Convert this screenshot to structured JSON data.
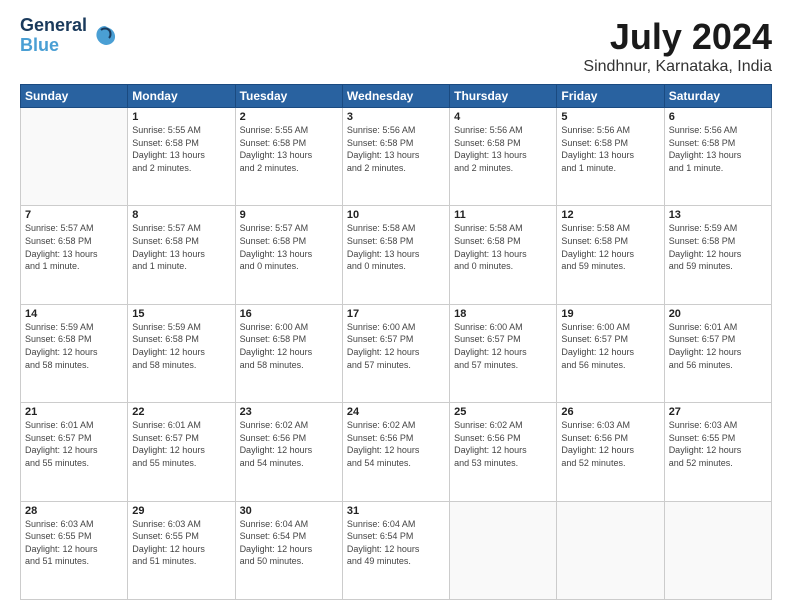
{
  "header": {
    "logo_line1": "General",
    "logo_line2": "Blue",
    "title": "July 2024",
    "subtitle": "Sindhnur, Karnataka, India"
  },
  "columns": [
    "Sunday",
    "Monday",
    "Tuesday",
    "Wednesday",
    "Thursday",
    "Friday",
    "Saturday"
  ],
  "weeks": [
    [
      {
        "day": "",
        "info": ""
      },
      {
        "day": "1",
        "info": "Sunrise: 5:55 AM\nSunset: 6:58 PM\nDaylight: 13 hours\nand 2 minutes."
      },
      {
        "day": "2",
        "info": "Sunrise: 5:55 AM\nSunset: 6:58 PM\nDaylight: 13 hours\nand 2 minutes."
      },
      {
        "day": "3",
        "info": "Sunrise: 5:56 AM\nSunset: 6:58 PM\nDaylight: 13 hours\nand 2 minutes."
      },
      {
        "day": "4",
        "info": "Sunrise: 5:56 AM\nSunset: 6:58 PM\nDaylight: 13 hours\nand 2 minutes."
      },
      {
        "day": "5",
        "info": "Sunrise: 5:56 AM\nSunset: 6:58 PM\nDaylight: 13 hours\nand 1 minute."
      },
      {
        "day": "6",
        "info": "Sunrise: 5:56 AM\nSunset: 6:58 PM\nDaylight: 13 hours\nand 1 minute."
      }
    ],
    [
      {
        "day": "7",
        "info": "Sunrise: 5:57 AM\nSunset: 6:58 PM\nDaylight: 13 hours\nand 1 minute."
      },
      {
        "day": "8",
        "info": "Sunrise: 5:57 AM\nSunset: 6:58 PM\nDaylight: 13 hours\nand 1 minute."
      },
      {
        "day": "9",
        "info": "Sunrise: 5:57 AM\nSunset: 6:58 PM\nDaylight: 13 hours\nand 0 minutes."
      },
      {
        "day": "10",
        "info": "Sunrise: 5:58 AM\nSunset: 6:58 PM\nDaylight: 13 hours\nand 0 minutes."
      },
      {
        "day": "11",
        "info": "Sunrise: 5:58 AM\nSunset: 6:58 PM\nDaylight: 13 hours\nand 0 minutes."
      },
      {
        "day": "12",
        "info": "Sunrise: 5:58 AM\nSunset: 6:58 PM\nDaylight: 12 hours\nand 59 minutes."
      },
      {
        "day": "13",
        "info": "Sunrise: 5:59 AM\nSunset: 6:58 PM\nDaylight: 12 hours\nand 59 minutes."
      }
    ],
    [
      {
        "day": "14",
        "info": "Sunrise: 5:59 AM\nSunset: 6:58 PM\nDaylight: 12 hours\nand 58 minutes."
      },
      {
        "day": "15",
        "info": "Sunrise: 5:59 AM\nSunset: 6:58 PM\nDaylight: 12 hours\nand 58 minutes."
      },
      {
        "day": "16",
        "info": "Sunrise: 6:00 AM\nSunset: 6:58 PM\nDaylight: 12 hours\nand 58 minutes."
      },
      {
        "day": "17",
        "info": "Sunrise: 6:00 AM\nSunset: 6:57 PM\nDaylight: 12 hours\nand 57 minutes."
      },
      {
        "day": "18",
        "info": "Sunrise: 6:00 AM\nSunset: 6:57 PM\nDaylight: 12 hours\nand 57 minutes."
      },
      {
        "day": "19",
        "info": "Sunrise: 6:00 AM\nSunset: 6:57 PM\nDaylight: 12 hours\nand 56 minutes."
      },
      {
        "day": "20",
        "info": "Sunrise: 6:01 AM\nSunset: 6:57 PM\nDaylight: 12 hours\nand 56 minutes."
      }
    ],
    [
      {
        "day": "21",
        "info": "Sunrise: 6:01 AM\nSunset: 6:57 PM\nDaylight: 12 hours\nand 55 minutes."
      },
      {
        "day": "22",
        "info": "Sunrise: 6:01 AM\nSunset: 6:57 PM\nDaylight: 12 hours\nand 55 minutes."
      },
      {
        "day": "23",
        "info": "Sunrise: 6:02 AM\nSunset: 6:56 PM\nDaylight: 12 hours\nand 54 minutes."
      },
      {
        "day": "24",
        "info": "Sunrise: 6:02 AM\nSunset: 6:56 PM\nDaylight: 12 hours\nand 54 minutes."
      },
      {
        "day": "25",
        "info": "Sunrise: 6:02 AM\nSunset: 6:56 PM\nDaylight: 12 hours\nand 53 minutes."
      },
      {
        "day": "26",
        "info": "Sunrise: 6:03 AM\nSunset: 6:56 PM\nDaylight: 12 hours\nand 52 minutes."
      },
      {
        "day": "27",
        "info": "Sunrise: 6:03 AM\nSunset: 6:55 PM\nDaylight: 12 hours\nand 52 minutes."
      }
    ],
    [
      {
        "day": "28",
        "info": "Sunrise: 6:03 AM\nSunset: 6:55 PM\nDaylight: 12 hours\nand 51 minutes."
      },
      {
        "day": "29",
        "info": "Sunrise: 6:03 AM\nSunset: 6:55 PM\nDaylight: 12 hours\nand 51 minutes."
      },
      {
        "day": "30",
        "info": "Sunrise: 6:04 AM\nSunset: 6:54 PM\nDaylight: 12 hours\nand 50 minutes."
      },
      {
        "day": "31",
        "info": "Sunrise: 6:04 AM\nSunset: 6:54 PM\nDaylight: 12 hours\nand 49 minutes."
      },
      {
        "day": "",
        "info": ""
      },
      {
        "day": "",
        "info": ""
      },
      {
        "day": "",
        "info": ""
      }
    ]
  ]
}
